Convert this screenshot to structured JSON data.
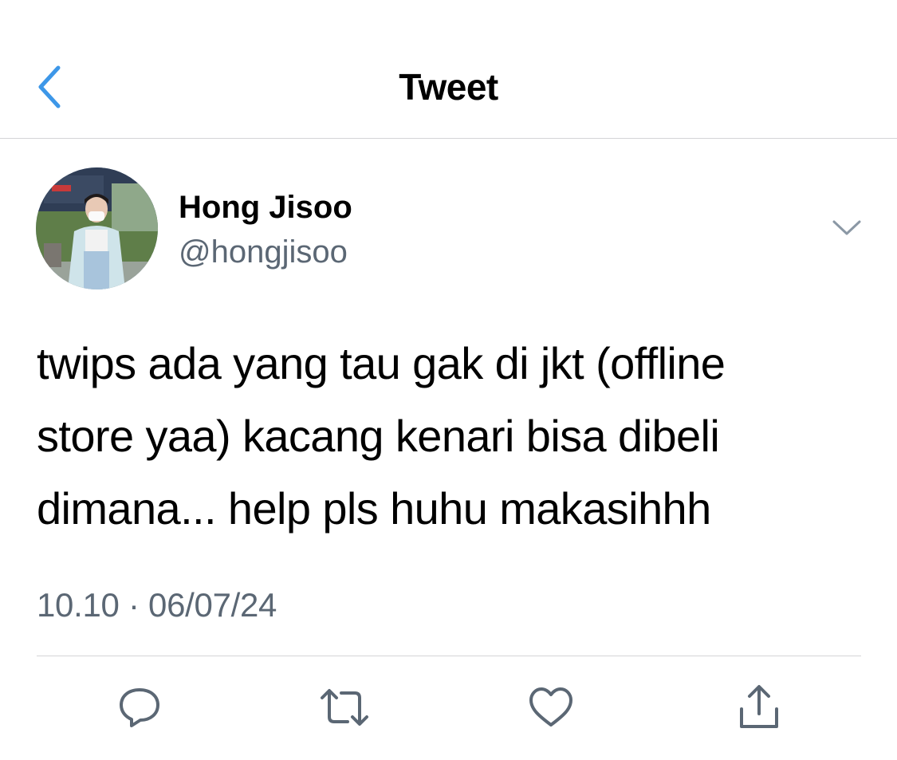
{
  "nav": {
    "title": "Tweet",
    "back_icon": "chevron-left-icon"
  },
  "author": {
    "display_name": "Hong Jisoo",
    "handle": "@hongjisoo",
    "avatar": "profile-photo"
  },
  "tweet": {
    "text": "twips ada yang tau gak di jkt (offline\nstore yaa) kacang kenari bisa dibeli\ndimana... help pls huhu makasihhh",
    "timestamp": "10.10 · 06/07/24"
  },
  "actions": [
    {
      "icon": "reply-icon"
    },
    {
      "icon": "retweet-icon"
    },
    {
      "icon": "like-icon"
    },
    {
      "icon": "share-icon"
    }
  ],
  "colors": {
    "accent": "#1d9bf0",
    "secondary_text": "#5b6774",
    "icon": "#5b6774",
    "divider": "#d4d4d6"
  }
}
